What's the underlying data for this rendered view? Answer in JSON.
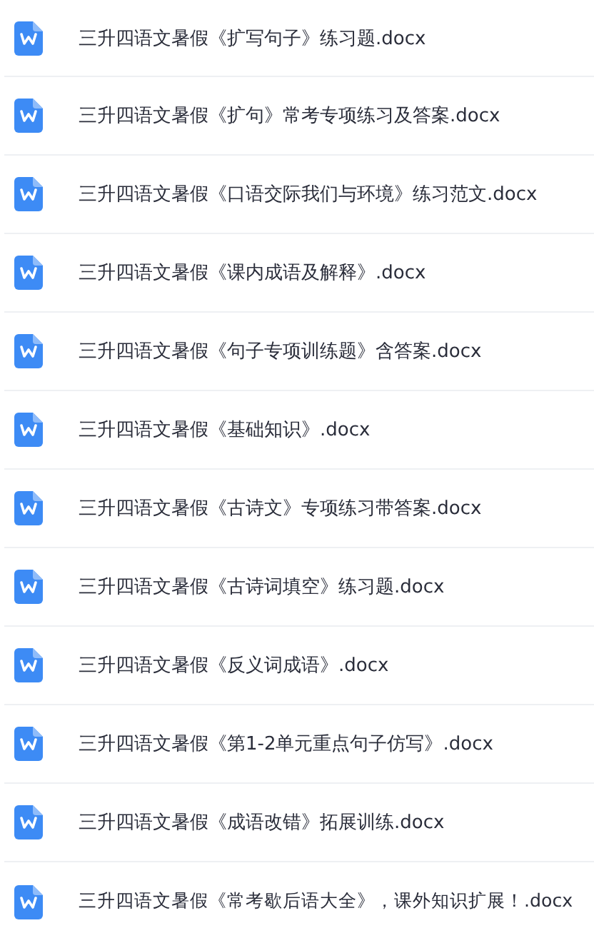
{
  "files": [
    {
      "name": "三升四语文暑假《扩写句子》练习题.docx"
    },
    {
      "name": "三升四语文暑假《扩句》常考专项练习及答案.docx"
    },
    {
      "name": "三升四语文暑假《口语交际我们与环境》练习范文.docx"
    },
    {
      "name": "三升四语文暑假《课内成语及解释》.docx"
    },
    {
      "name": "三升四语文暑假《句子专项训练题》含答案.docx"
    },
    {
      "name": "三升四语文暑假《基础知识》.docx"
    },
    {
      "name": "三升四语文暑假《古诗文》专项练习带答案.docx"
    },
    {
      "name": "三升四语文暑假《古诗词填空》练习题.docx"
    },
    {
      "name": "三升四语文暑假《反义词成语》.docx"
    },
    {
      "name": "三升四语文暑假《第1-2单元重点句子仿写》.docx"
    },
    {
      "name": "三升四语文暑假《成语改错》拓展训练.docx"
    },
    {
      "name": "三升四语文暑假《常考歇后语大全》，课外知识扩展！.docx"
    }
  ]
}
